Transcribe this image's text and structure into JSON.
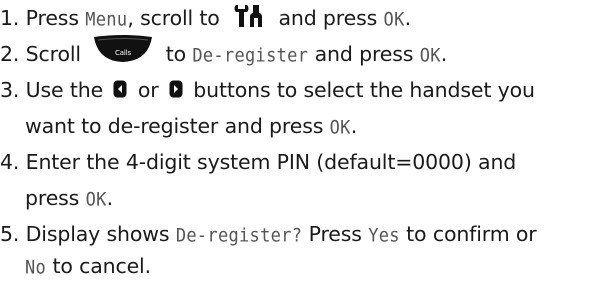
{
  "steps": [
    {
      "number": "1.",
      "press": "Press",
      "menu_key": "Menu",
      "scroll_to": ", scroll to",
      "icon": "tools-icon",
      "and_press": "and press",
      "ok_key": "OK",
      "end": "."
    },
    {
      "number": "2.",
      "scroll": "Scroll",
      "icon": "calls-scroll-key-icon",
      "calls_label": "Calls",
      "to": "to",
      "screen_text": "De-register",
      "and_press": "and press",
      "ok_key": "OK",
      "end": "."
    },
    {
      "number": "3.",
      "use_the": "Use the",
      "left_icon": "left-arrow-key-icon",
      "or": "or",
      "right_icon": "right-arrow-key-icon",
      "rest_line1": "buttons to select the handset you",
      "line2": "want to de-register and press",
      "ok_key": "OK",
      "end": "."
    },
    {
      "number": "4.",
      "line1": "Enter the 4-digit system PIN (default=0000) and",
      "line2": "press",
      "ok_key": "OK",
      "end": "."
    },
    {
      "number": "5.",
      "display_shows": "Display shows",
      "screen_text": "De-register?",
      "press": "Press",
      "yes_key": "Yes",
      "confirm_or": "to confirm or",
      "no_key": "No",
      "cancel": "to cancel."
    }
  ],
  "colors": {
    "text": "#1a1a1a",
    "lcd_text": "#555555",
    "icon": "#111111"
  }
}
